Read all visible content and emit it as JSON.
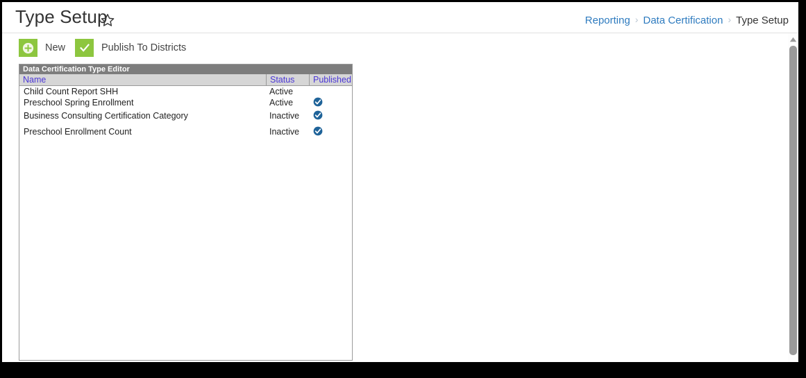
{
  "header": {
    "title": "Type Setup",
    "favorite_icon": "star-outline-icon"
  },
  "breadcrumb": {
    "separator": "›",
    "items": [
      {
        "label": "Reporting",
        "current": false
      },
      {
        "label": "Data Certification",
        "current": false
      },
      {
        "label": "Type Setup",
        "current": true
      }
    ]
  },
  "toolbar": {
    "new_label": "New",
    "new_icon": "plus-circle-icon",
    "publish_label": "Publish To Districts",
    "publish_icon": "checkmark-icon",
    "accent_green": "#8dc63f"
  },
  "grid": {
    "caption": "Data Certification Type Editor",
    "columns": [
      {
        "key": "name",
        "label": "Name"
      },
      {
        "key": "status",
        "label": "Status"
      },
      {
        "key": "published",
        "label": "Published"
      }
    ],
    "header_color": "#4b37d6",
    "caption_bg": "#7d7d7d",
    "check_color": "#1f6399",
    "rows": [
      {
        "name": "Child Count Report SHH",
        "status": "Active",
        "published": false,
        "spacing": "compact"
      },
      {
        "name": "Preschool Spring Enrollment",
        "status": "Active",
        "published": true,
        "spacing": "compact"
      },
      {
        "name": "Business Consulting Certification Category",
        "status": "Inactive",
        "published": true,
        "spacing": "tall"
      },
      {
        "name": "Preschool Enrollment Count",
        "status": "Inactive",
        "published": true,
        "spacing": "tall"
      }
    ]
  },
  "scrollbar": {
    "up_arrow_icon": "triangle-up-icon",
    "thumb_color": "#9a9a9a"
  }
}
